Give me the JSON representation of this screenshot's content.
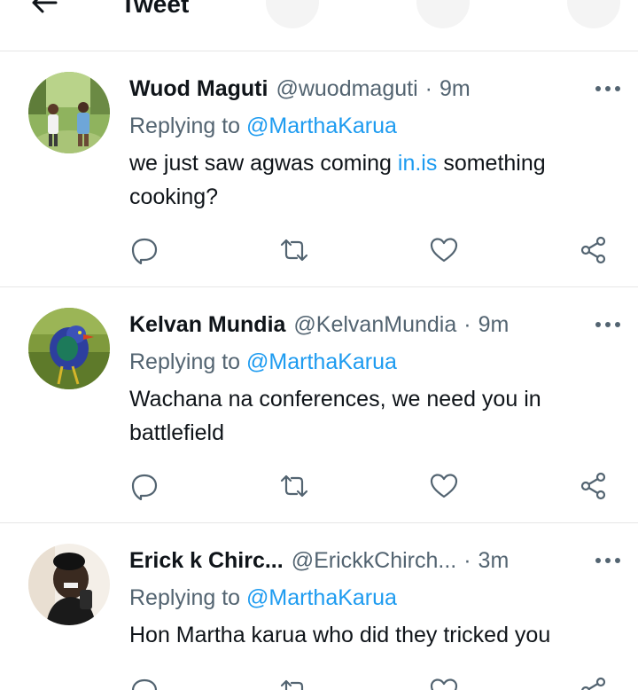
{
  "header": {
    "title": "Tweet",
    "back_icon": "arrow-left-icon"
  },
  "colors": {
    "link": "#1d9bf0",
    "secondary_text": "#536471",
    "primary_text": "#0f1419",
    "divider": "#e6e6e6"
  },
  "replying_label": "Replying to",
  "tweets": [
    {
      "name": "Wuod Maguti",
      "handle": "@wuodmaguti",
      "separator": "·",
      "time": "9m",
      "mention": "@MarthaKarua",
      "text_before": "we just saw agwas coming ",
      "text_link": "in.is",
      "text_after": " something cooking?"
    },
    {
      "name": "Kelvan Mundia",
      "handle": "@KelvanMundia",
      "separator": "·",
      "time": "9m",
      "mention": "@MarthaKarua",
      "text": "Wachana na conferences, we need you in battlefield"
    },
    {
      "name": "Erick k Chirc...",
      "handle": "@ErickkChirch...",
      "separator": "·",
      "time": "3m",
      "mention": "@MarthaKarua",
      "text": "Hon Martha karua who did they tricked you"
    }
  ],
  "action_icons": [
    "reply-icon",
    "retweet-icon",
    "like-icon",
    "share-icon"
  ]
}
